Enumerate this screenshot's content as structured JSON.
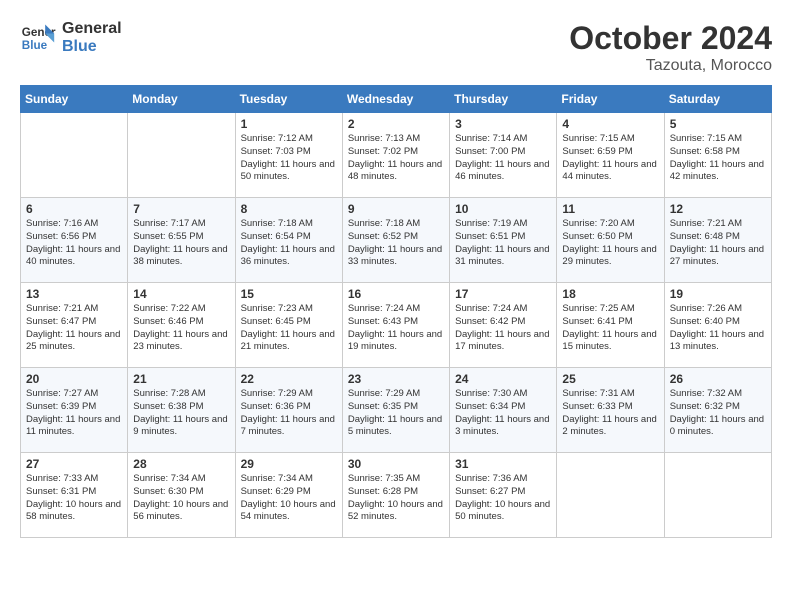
{
  "header": {
    "logo_line1": "General",
    "logo_line2": "Blue",
    "month_title": "October 2024",
    "location": "Tazouta, Morocco"
  },
  "days_of_week": [
    "Sunday",
    "Monday",
    "Tuesday",
    "Wednesday",
    "Thursday",
    "Friday",
    "Saturday"
  ],
  "weeks": [
    [
      {
        "day": "",
        "info": ""
      },
      {
        "day": "",
        "info": ""
      },
      {
        "day": "1",
        "info": "Sunrise: 7:12 AM\nSunset: 7:03 PM\nDaylight: 11 hours and 50 minutes."
      },
      {
        "day": "2",
        "info": "Sunrise: 7:13 AM\nSunset: 7:02 PM\nDaylight: 11 hours and 48 minutes."
      },
      {
        "day": "3",
        "info": "Sunrise: 7:14 AM\nSunset: 7:00 PM\nDaylight: 11 hours and 46 minutes."
      },
      {
        "day": "4",
        "info": "Sunrise: 7:15 AM\nSunset: 6:59 PM\nDaylight: 11 hours and 44 minutes."
      },
      {
        "day": "5",
        "info": "Sunrise: 7:15 AM\nSunset: 6:58 PM\nDaylight: 11 hours and 42 minutes."
      }
    ],
    [
      {
        "day": "6",
        "info": "Sunrise: 7:16 AM\nSunset: 6:56 PM\nDaylight: 11 hours and 40 minutes."
      },
      {
        "day": "7",
        "info": "Sunrise: 7:17 AM\nSunset: 6:55 PM\nDaylight: 11 hours and 38 minutes."
      },
      {
        "day": "8",
        "info": "Sunrise: 7:18 AM\nSunset: 6:54 PM\nDaylight: 11 hours and 36 minutes."
      },
      {
        "day": "9",
        "info": "Sunrise: 7:18 AM\nSunset: 6:52 PM\nDaylight: 11 hours and 33 minutes."
      },
      {
        "day": "10",
        "info": "Sunrise: 7:19 AM\nSunset: 6:51 PM\nDaylight: 11 hours and 31 minutes."
      },
      {
        "day": "11",
        "info": "Sunrise: 7:20 AM\nSunset: 6:50 PM\nDaylight: 11 hours and 29 minutes."
      },
      {
        "day": "12",
        "info": "Sunrise: 7:21 AM\nSunset: 6:48 PM\nDaylight: 11 hours and 27 minutes."
      }
    ],
    [
      {
        "day": "13",
        "info": "Sunrise: 7:21 AM\nSunset: 6:47 PM\nDaylight: 11 hours and 25 minutes."
      },
      {
        "day": "14",
        "info": "Sunrise: 7:22 AM\nSunset: 6:46 PM\nDaylight: 11 hours and 23 minutes."
      },
      {
        "day": "15",
        "info": "Sunrise: 7:23 AM\nSunset: 6:45 PM\nDaylight: 11 hours and 21 minutes."
      },
      {
        "day": "16",
        "info": "Sunrise: 7:24 AM\nSunset: 6:43 PM\nDaylight: 11 hours and 19 minutes."
      },
      {
        "day": "17",
        "info": "Sunrise: 7:24 AM\nSunset: 6:42 PM\nDaylight: 11 hours and 17 minutes."
      },
      {
        "day": "18",
        "info": "Sunrise: 7:25 AM\nSunset: 6:41 PM\nDaylight: 11 hours and 15 minutes."
      },
      {
        "day": "19",
        "info": "Sunrise: 7:26 AM\nSunset: 6:40 PM\nDaylight: 11 hours and 13 minutes."
      }
    ],
    [
      {
        "day": "20",
        "info": "Sunrise: 7:27 AM\nSunset: 6:39 PM\nDaylight: 11 hours and 11 minutes."
      },
      {
        "day": "21",
        "info": "Sunrise: 7:28 AM\nSunset: 6:38 PM\nDaylight: 11 hours and 9 minutes."
      },
      {
        "day": "22",
        "info": "Sunrise: 7:29 AM\nSunset: 6:36 PM\nDaylight: 11 hours and 7 minutes."
      },
      {
        "day": "23",
        "info": "Sunrise: 7:29 AM\nSunset: 6:35 PM\nDaylight: 11 hours and 5 minutes."
      },
      {
        "day": "24",
        "info": "Sunrise: 7:30 AM\nSunset: 6:34 PM\nDaylight: 11 hours and 3 minutes."
      },
      {
        "day": "25",
        "info": "Sunrise: 7:31 AM\nSunset: 6:33 PM\nDaylight: 11 hours and 2 minutes."
      },
      {
        "day": "26",
        "info": "Sunrise: 7:32 AM\nSunset: 6:32 PM\nDaylight: 11 hours and 0 minutes."
      }
    ],
    [
      {
        "day": "27",
        "info": "Sunrise: 7:33 AM\nSunset: 6:31 PM\nDaylight: 10 hours and 58 minutes."
      },
      {
        "day": "28",
        "info": "Sunrise: 7:34 AM\nSunset: 6:30 PM\nDaylight: 10 hours and 56 minutes."
      },
      {
        "day": "29",
        "info": "Sunrise: 7:34 AM\nSunset: 6:29 PM\nDaylight: 10 hours and 54 minutes."
      },
      {
        "day": "30",
        "info": "Sunrise: 7:35 AM\nSunset: 6:28 PM\nDaylight: 10 hours and 52 minutes."
      },
      {
        "day": "31",
        "info": "Sunrise: 7:36 AM\nSunset: 6:27 PM\nDaylight: 10 hours and 50 minutes."
      },
      {
        "day": "",
        "info": ""
      },
      {
        "day": "",
        "info": ""
      }
    ]
  ]
}
